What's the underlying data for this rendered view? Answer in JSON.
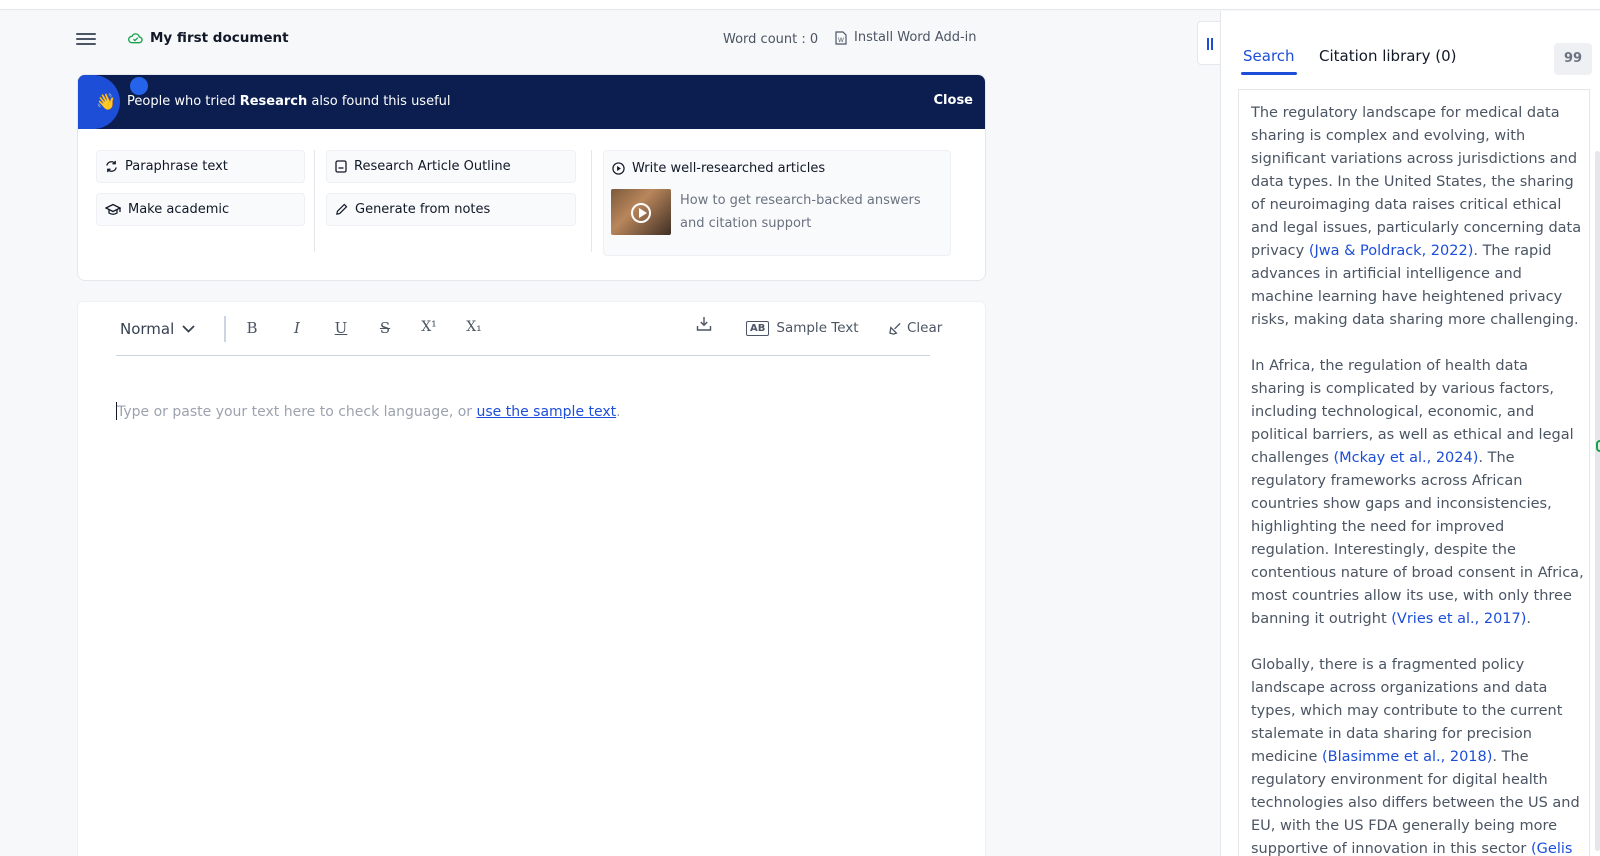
{
  "header": {
    "doc_title": "My first document",
    "word_count": "Word count : 0",
    "install_addin": "Install Word Add-in"
  },
  "banner": {
    "prefix": "People who tried ",
    "highlight": "Research",
    "suffix": " also found this useful",
    "close_label": "Close"
  },
  "tools": {
    "paraphrase": "Paraphrase text",
    "make_academic": "Make academic",
    "outline": "Research Article Outline",
    "generate_notes": "Generate from notes"
  },
  "article": {
    "title": "Write well-researched articles",
    "desc": "How to get research-backed answers and citation support"
  },
  "toolbar": {
    "style_value": "Normal",
    "bold": "B",
    "italic": "I",
    "underline": "U",
    "strike": "S",
    "superscript": "X¹",
    "subscript": "X₁",
    "ab_box": "AB",
    "sample_text": "Sample Text",
    "clear": "Clear"
  },
  "editor": {
    "placeholder": "Type or paste your text here to check language, or ",
    "sample_link": "use the sample text",
    "period": "."
  },
  "side_panel": {
    "tab_search": "Search",
    "tab_citation": "Citation library (0)",
    "quote_icon": "99",
    "p1": {
      "a": "The regulatory landscape for medical data sharing is complex and evolving, with significant variations across jurisdictions and data types. In the United States, the sharing of neuroimaging data raises critical ethical and legal issues, particularly concerning data privacy ",
      "cite1": "(Jwa & Poldrack, 2022)",
      "b": ". The rapid advances in artificial intelligence and machine learning have heightened privacy risks, making data sharing more challenging."
    },
    "p2": {
      "a": "In Africa, the regulation of health data sharing is complicated by various factors, including technological, economic, and political barriers, as well as ethical and legal challenges ",
      "cite1": "(Mckay et al., 2024)",
      "b": ". The regulatory frameworks across African countries show gaps and inconsistencies, highlighting the need for improved regulation. Interestingly, despite the contentious nature of broad consent in Africa, most countries allow its use, with only three banning it outright ",
      "cite2": "(Vries et al., 2017)",
      "c": "."
    },
    "p3": {
      "a": "Globally, there is a fragmented policy landscape across organizations and data types, which may contribute to the current stalemate in data sharing for precision medicine ",
      "cite1": "(Blasimme et al., 2018)",
      "b": ". The regulatory environment for digital health technologies also differs between the US and EU, with the US FDA generally being more supportive of innovation in this sector ",
      "cite2": "(Gelis"
    }
  }
}
